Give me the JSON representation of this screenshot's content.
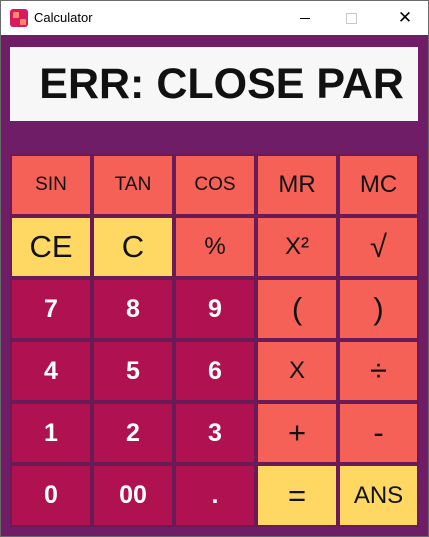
{
  "window": {
    "title": "Calculator",
    "controls": {
      "minimize": "minimize",
      "maximize": "maximize",
      "close": "✕"
    }
  },
  "display": {
    "text": "ERR: CLOSE PAR"
  },
  "colors": {
    "background": "#6f1d66",
    "coral": "#f66157",
    "yellow": "#ffd864",
    "crimson": "#b01150",
    "display": "#f7f7f7"
  },
  "keys": {
    "sin": "SIN",
    "tan": "TAN",
    "cos": "COS",
    "mr": "MR",
    "mc": "MC",
    "ce": "CE",
    "c": "C",
    "percent": "%",
    "square": "X²",
    "sqrt": "√",
    "seven": "7",
    "eight": "8",
    "nine": "9",
    "lparen": "(",
    "rparen": ")",
    "four": "4",
    "five": "5",
    "six": "6",
    "multiply": "X",
    "divide": "÷",
    "one": "1",
    "two": "2",
    "three": "3",
    "plus": "+",
    "minus": "-",
    "zero": "0",
    "double_zero": "00",
    "dot": ".",
    "equals": "=",
    "ans": "ANS"
  }
}
